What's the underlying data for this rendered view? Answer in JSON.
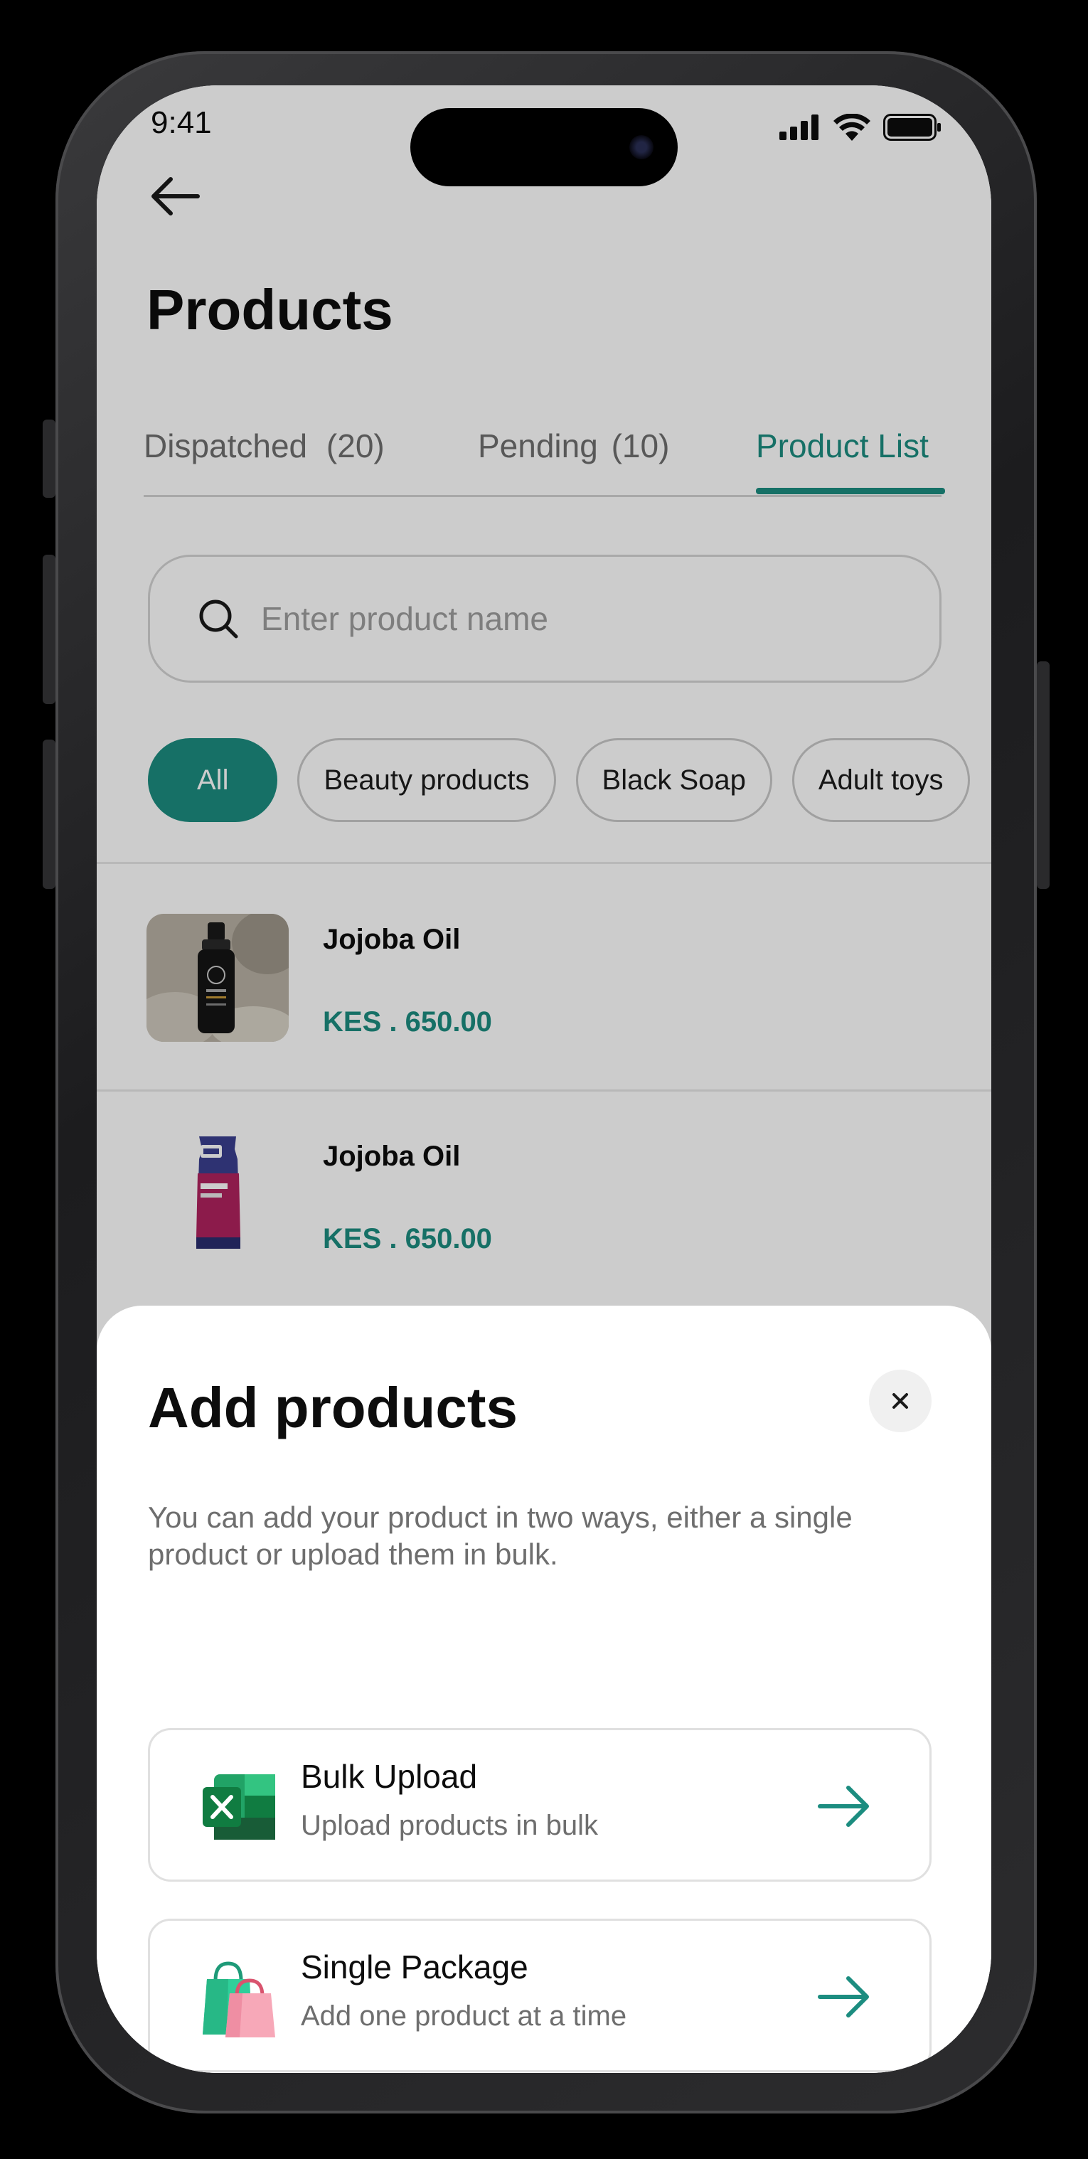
{
  "status_bar": {
    "time": "9:41"
  },
  "header": {
    "title": "Products"
  },
  "tabs": [
    {
      "label": "Dispatched",
      "count": "(20)"
    },
    {
      "label": "Pending",
      "count": "(10)"
    },
    {
      "label": "Product List"
    }
  ],
  "search": {
    "placeholder": "Enter product name"
  },
  "filters": [
    "All",
    "Beauty products",
    "Black Soap",
    "Adult toys"
  ],
  "products": [
    {
      "name": "Jojoba Oil",
      "price": "KES . 650.00"
    },
    {
      "name": "Jojoba Oil",
      "price": "KES . 650.00"
    }
  ],
  "sheet": {
    "title": "Add products",
    "description": "You can add your product in two ways, either a single product or upload them in bulk.",
    "options": [
      {
        "title": "Bulk Upload",
        "subtitle": "Upload products in bulk",
        "icon": "excel-icon"
      },
      {
        "title": "Single Package",
        "subtitle": "Add one product at a time",
        "icon": "shopping-bags-icon"
      }
    ]
  },
  "colors": {
    "accent": "#1c8d80",
    "text": "#0d0d0d",
    "muted": "#6e6e6e"
  }
}
